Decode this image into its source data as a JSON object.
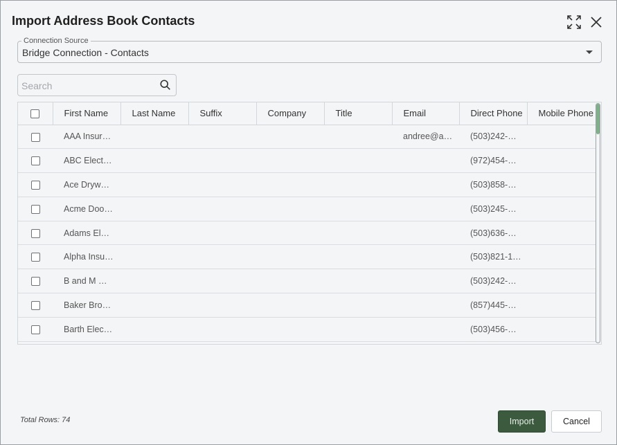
{
  "dialog": {
    "title": "Import Address Book Contacts",
    "expand_icon": "expand-icon",
    "close_icon": "close-icon"
  },
  "source": {
    "legend": "Connection Source",
    "value": "Bridge Connection - Contacts"
  },
  "search": {
    "placeholder": "Search",
    "icon": "search-icon"
  },
  "table": {
    "columns": [
      "First Name",
      "Last Name",
      "Suffix",
      "Company",
      "Title",
      "Email",
      "Direct Phone",
      "Mobile Phone"
    ],
    "rows": [
      {
        "first": "AAA Insur…",
        "last": "",
        "suffix": "",
        "company": "",
        "title": "",
        "email": "andree@a…",
        "direct": "(503)242-…",
        "mobile": ""
      },
      {
        "first": "ABC Elect…",
        "last": "",
        "suffix": "",
        "company": "",
        "title": "",
        "email": "",
        "direct": "(972)454-…",
        "mobile": ""
      },
      {
        "first": "Ace Dryw…",
        "last": "",
        "suffix": "",
        "company": "",
        "title": "",
        "email": "",
        "direct": "(503)858-…",
        "mobile": ""
      },
      {
        "first": "Acme Doo…",
        "last": "",
        "suffix": "",
        "company": "",
        "title": "",
        "email": "",
        "direct": "(503)245-…",
        "mobile": ""
      },
      {
        "first": "Adams El…",
        "last": "",
        "suffix": "",
        "company": "",
        "title": "",
        "email": "",
        "direct": "(503)636-…",
        "mobile": ""
      },
      {
        "first": "Alpha Insu…",
        "last": "",
        "suffix": "",
        "company": "",
        "title": "",
        "email": "",
        "direct": "(503)821-1…",
        "mobile": ""
      },
      {
        "first": "B and M …",
        "last": "",
        "suffix": "",
        "company": "",
        "title": "",
        "email": "",
        "direct": "(503)242-…",
        "mobile": ""
      },
      {
        "first": "Baker Bro…",
        "last": "",
        "suffix": "",
        "company": "",
        "title": "",
        "email": "",
        "direct": "(857)445-…",
        "mobile": ""
      },
      {
        "first": "Barth Elec…",
        "last": "",
        "suffix": "",
        "company": "",
        "title": "",
        "email": "",
        "direct": "(503)456-…",
        "mobile": ""
      }
    ]
  },
  "footer": {
    "total_rows": "Total Rows: 74",
    "import_label": "Import",
    "cancel_label": "Cancel"
  },
  "colors": {
    "primary_button": "#3b5a3e",
    "scroll_thumb": "#7fb08a",
    "background": "#f4f5f7"
  }
}
